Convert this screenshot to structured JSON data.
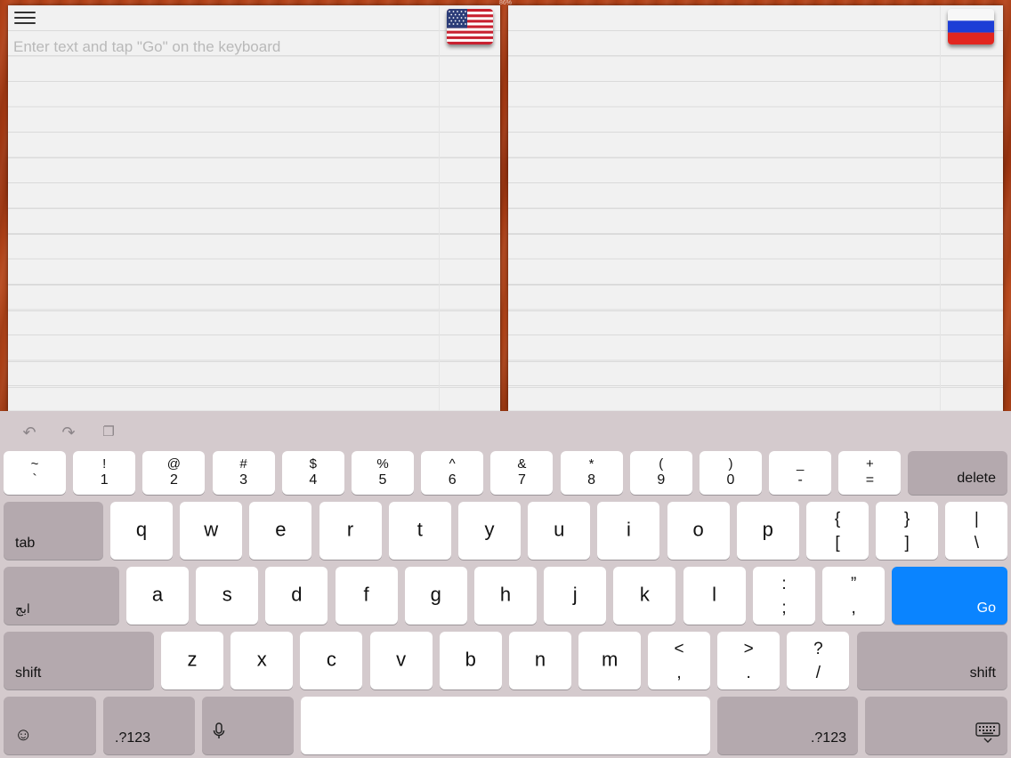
{
  "status_bar": {
    "center_text": "86%"
  },
  "left_panel": {
    "placeholder": "Enter text and tap \"Go\" on the keyboard",
    "flag": "us-flag"
  },
  "right_panel": {
    "flag": "russia-flag"
  },
  "shortcut_bar": {
    "undo": "↶",
    "redo": "↷",
    "paste": "❐"
  },
  "keyboard": {
    "number_row": [
      {
        "top": "~",
        "bottom": "`"
      },
      {
        "top": "!",
        "bottom": "1"
      },
      {
        "top": "@",
        "bottom": "2"
      },
      {
        "top": "#",
        "bottom": "3"
      },
      {
        "top": "$",
        "bottom": "4"
      },
      {
        "top": "%",
        "bottom": "5"
      },
      {
        "top": "^",
        "bottom": "6"
      },
      {
        "top": "&",
        "bottom": "7"
      },
      {
        "top": "*",
        "bottom": "8"
      },
      {
        "top": "(",
        "bottom": "9"
      },
      {
        "top": ")",
        "bottom": "0"
      },
      {
        "top": "_",
        "bottom": "-"
      },
      {
        "top": "+",
        "bottom": "="
      }
    ],
    "delete": "delete",
    "tab": "tab",
    "row2": [
      "q",
      "w",
      "e",
      "r",
      "t",
      "y",
      "u",
      "i",
      "o",
      "p"
    ],
    "row2_symbols": [
      {
        "top": "{",
        "bottom": "["
      },
      {
        "top": "}",
        "bottom": "]"
      },
      {
        "top": "|",
        "bottom": "\\"
      }
    ],
    "lang": "ابج",
    "row3": [
      "a",
      "s",
      "d",
      "f",
      "g",
      "h",
      "j",
      "k",
      "l"
    ],
    "row3_symbols": [
      {
        "top": ":",
        "bottom": ";"
      },
      {
        "top": "”",
        "bottom": ","
      }
    ],
    "go": "Go",
    "shift": "shift",
    "row4": [
      "z",
      "x",
      "c",
      "v",
      "b",
      "n",
      "m"
    ],
    "row4_symbols": [
      {
        "top": "<",
        "bottom": ","
      },
      {
        "top": ">",
        "bottom": "."
      },
      {
        "top": "?",
        "bottom": "/"
      }
    ],
    "emoji": "☺",
    "numbers_left": ".?123",
    "mic": "🎙",
    "numbers_right": ".?123",
    "hide_keyboard": "⌨"
  },
  "colors": {
    "go_key": "#0a84ff",
    "keyboard_bg": "#d4cacd",
    "dark_key": "#b4a9ae"
  }
}
